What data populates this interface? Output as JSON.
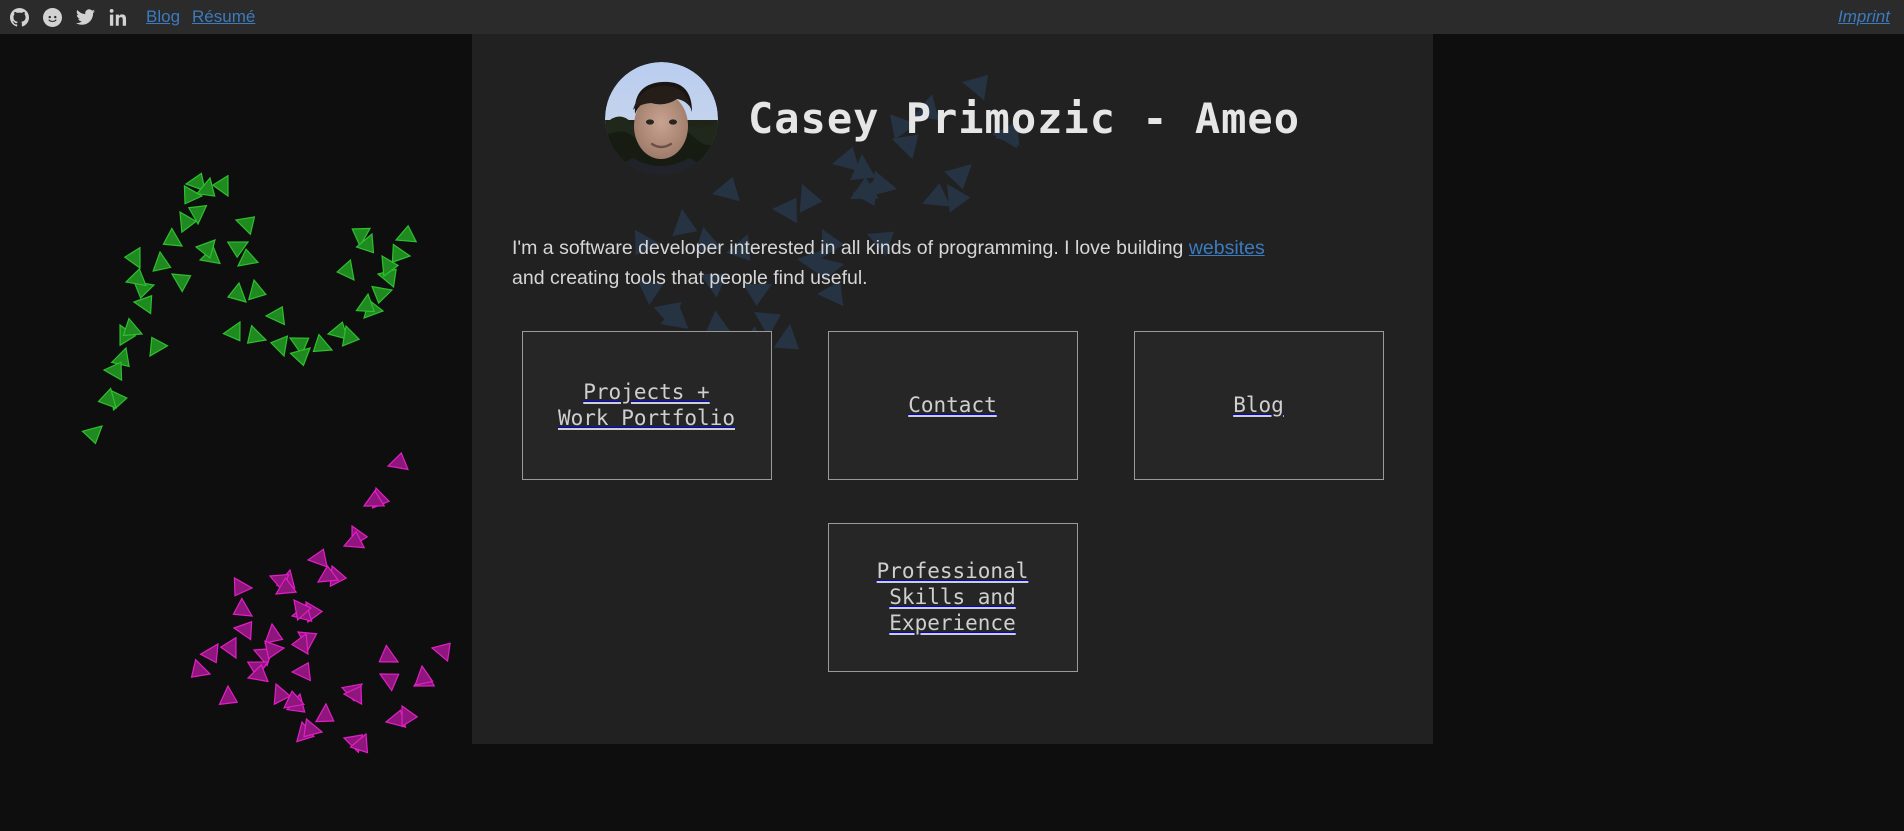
{
  "theme": {
    "page_background": "#0e0e0e",
    "panel_background": "#212121",
    "topbar_background": "#2b2b2b",
    "link_color": "#3b7bbf",
    "text_color": "#d6d6d6",
    "tile_border": "#9a9a9a",
    "fractal_green": "#1f8a1f",
    "fractal_magenta": "#b5189c",
    "fractal_panel_blue": "#2a3a4d"
  },
  "topbar": {
    "social_icons": [
      {
        "name": "github-icon",
        "label": "GitHub"
      },
      {
        "name": "reddit-icon",
        "label": "Reddit"
      },
      {
        "name": "twitter-icon",
        "label": "Twitter"
      },
      {
        "name": "linkedin-icon",
        "label": "LinkedIn"
      }
    ],
    "links": [
      {
        "label": "Blog"
      },
      {
        "label": "Résumé"
      }
    ],
    "imprint_label": "Imprint"
  },
  "header": {
    "title": "Casey Primozic - Ameo",
    "avatar_alt": "Casey Primozic profile photo"
  },
  "intro": {
    "text_before_link": "I'm a software developer interested in all kinds of programming. I love building ",
    "link_label": "websites",
    "text_after_link": " and creating tools that people find useful."
  },
  "tiles": {
    "row1": [
      {
        "label": "Projects +\nWork Portfolio"
      },
      {
        "label": "Contact"
      },
      {
        "label": "Blog"
      }
    ],
    "row2": [
      {
        "label": "Professional\nSkills and\nExperience"
      }
    ]
  }
}
